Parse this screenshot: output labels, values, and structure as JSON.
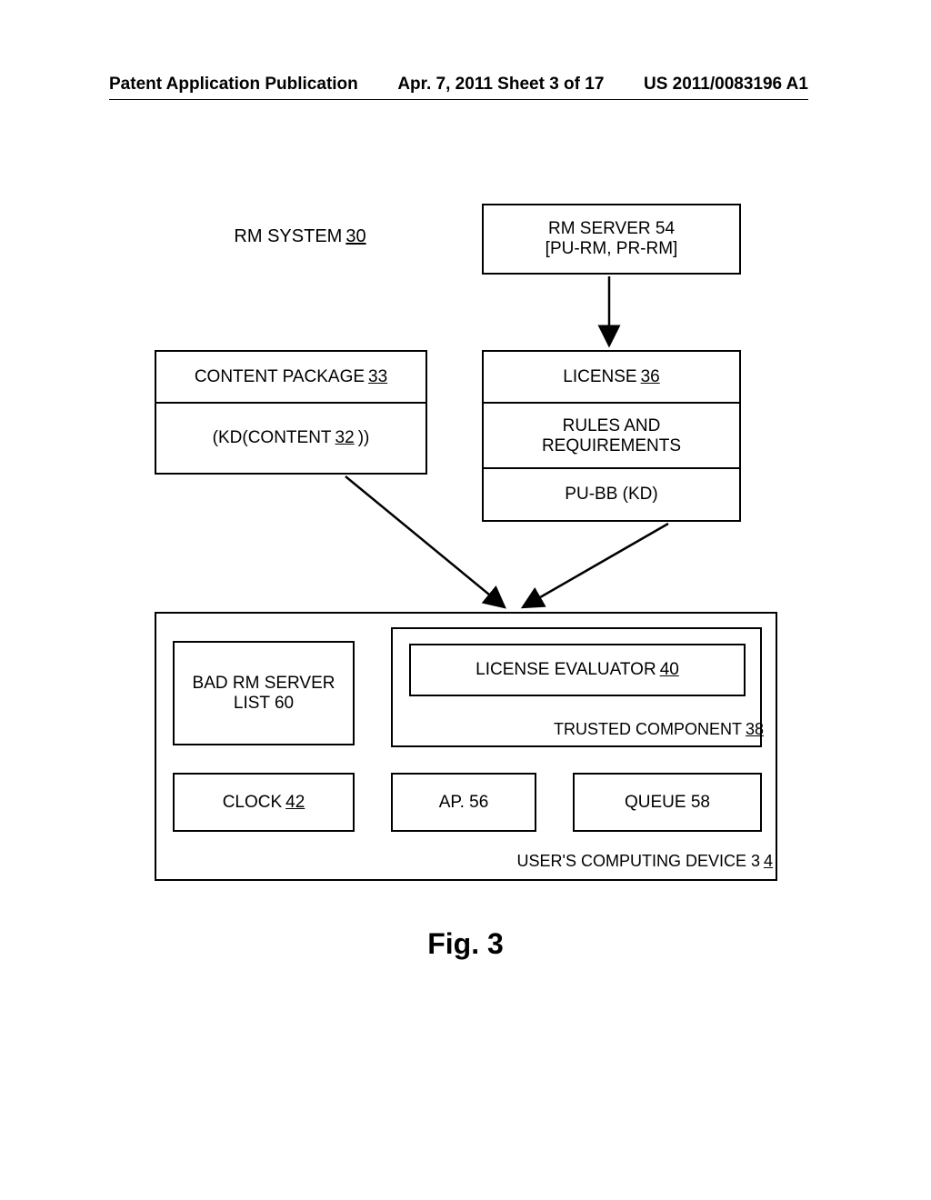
{
  "header": {
    "left": "Patent Application Publication",
    "center": "Apr. 7, 2011  Sheet 3 of 17",
    "right": "US 2011/0083196 A1"
  },
  "labels": {
    "rm_system": "RM SYSTEM ",
    "rm_system_num": "30",
    "rm_server_l1": "RM SERVER 54",
    "rm_server_l2": "[PU-RM, PR-RM]",
    "content_pkg": "CONTENT PACKAGE ",
    "content_pkg_num": "33",
    "kd_pre": "(KD(CONTENT ",
    "kd_num": "32",
    "kd_post": "))",
    "license": "LICENSE ",
    "license_num": "36",
    "rules_l1": "RULES AND",
    "rules_l2": "REQUIREMENTS",
    "pubb": "PU-BB (KD)",
    "bad_l1": "BAD RM SERVER",
    "bad_l2": "LIST 60",
    "lic_eval": "LICENSE EVALUATOR ",
    "lic_eval_num": "40",
    "trusted": "TRUSTED COMPONENT ",
    "trusted_num": "38",
    "clock": "CLOCK ",
    "clock_num": "42",
    "ap": "AP. 56",
    "queue": "QUEUE 58",
    "device": "USER'S COMPUTING DEVICE 3",
    "device_num": "4",
    "figure": "Fig. 3"
  }
}
